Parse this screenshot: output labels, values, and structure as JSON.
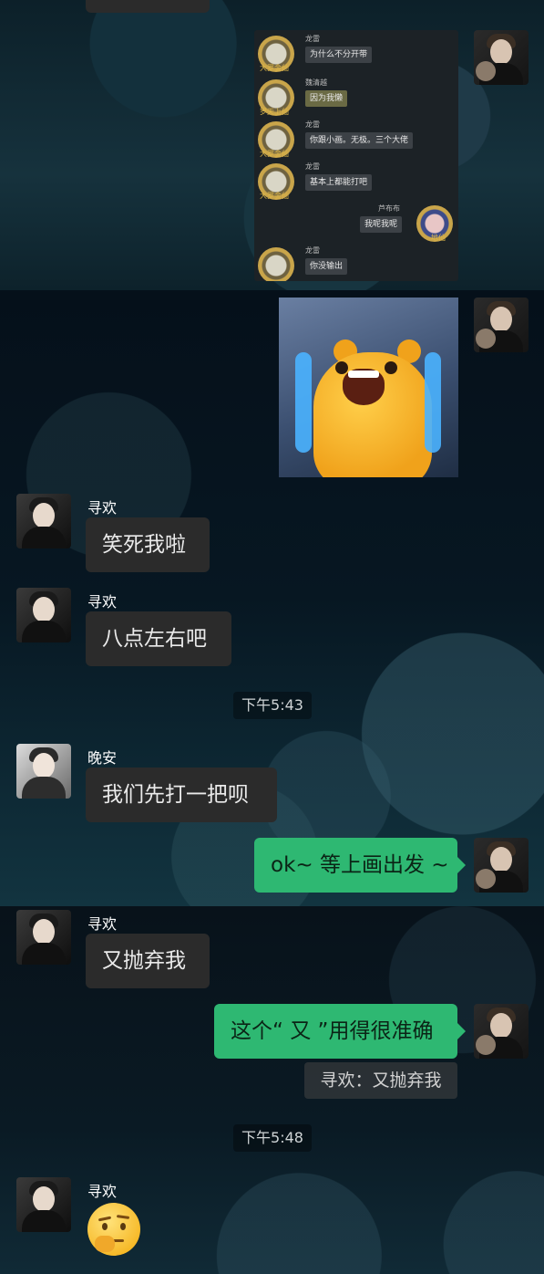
{
  "screenshot_chat": {
    "rows": [
      {
        "name": "龙雷",
        "rank": "大罗金仙",
        "text": "为什么不分开带",
        "highlight": false
      },
      {
        "name": "魏清越",
        "rank": "罗天上仙",
        "text": "因为我懒",
        "highlight": true
      },
      {
        "name": "龙雷",
        "rank": "大罗金仙",
        "text": "你跟小画。无极。三个大佬",
        "highlight": false
      },
      {
        "name": "龙雷",
        "rank": "大罗金仙",
        "text": "基本上都能打吧",
        "highlight": false
      },
      {
        "name": "芦布布",
        "rank": "地仙",
        "text": "我呢我呢",
        "highlight": false
      },
      {
        "name": "龙雷",
        "rank": "大罗金仙",
        "text": "你没输出",
        "highlight": false
      }
    ]
  },
  "messages": [
    {
      "sender": "寻欢",
      "text": "笑死我啦"
    },
    {
      "sender": "寻欢",
      "text": "八点左右吧"
    },
    {
      "time": "下午5:43"
    },
    {
      "sender": "晚安",
      "text": "我们先打一把呗"
    },
    {
      "sender": "me",
      "text": "ok~ 等上画出发 ~"
    },
    {
      "sender": "寻欢",
      "text": "又抛弃我"
    },
    {
      "sender": "me",
      "text": "这个“ 又 ”用得很准确"
    },
    {
      "quote": "寻欢：又抛弃我"
    },
    {
      "time": "下午5:48"
    },
    {
      "sender": "寻欢",
      "emoji": "thinking-face-icon"
    }
  ],
  "colors": {
    "bubble_left": "#2b2b2b",
    "bubble_right": "#2eb872"
  }
}
